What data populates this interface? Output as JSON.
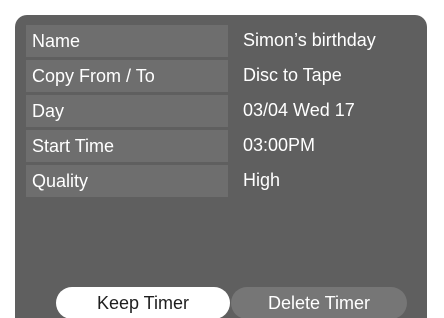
{
  "timer_details": {
    "rows": [
      {
        "label": "Name",
        "value": "Simon’s birthday"
      },
      {
        "label": "Copy From / To",
        "value": "Disc to Tape"
      },
      {
        "label": "Day",
        "value": "03/04 Wed 17"
      },
      {
        "label": "Start Time",
        "value": "03:00PM"
      },
      {
        "label": "Quality",
        "value": "High"
      }
    ]
  },
  "actions": {
    "keep_label": "Keep Timer",
    "delete_label": "Delete Timer"
  },
  "colors": {
    "panel_background": "#5f5f5f",
    "label_cell_background": "#6e6e6e",
    "selected_button": "#ffffff",
    "unselected_button": "#767676"
  }
}
